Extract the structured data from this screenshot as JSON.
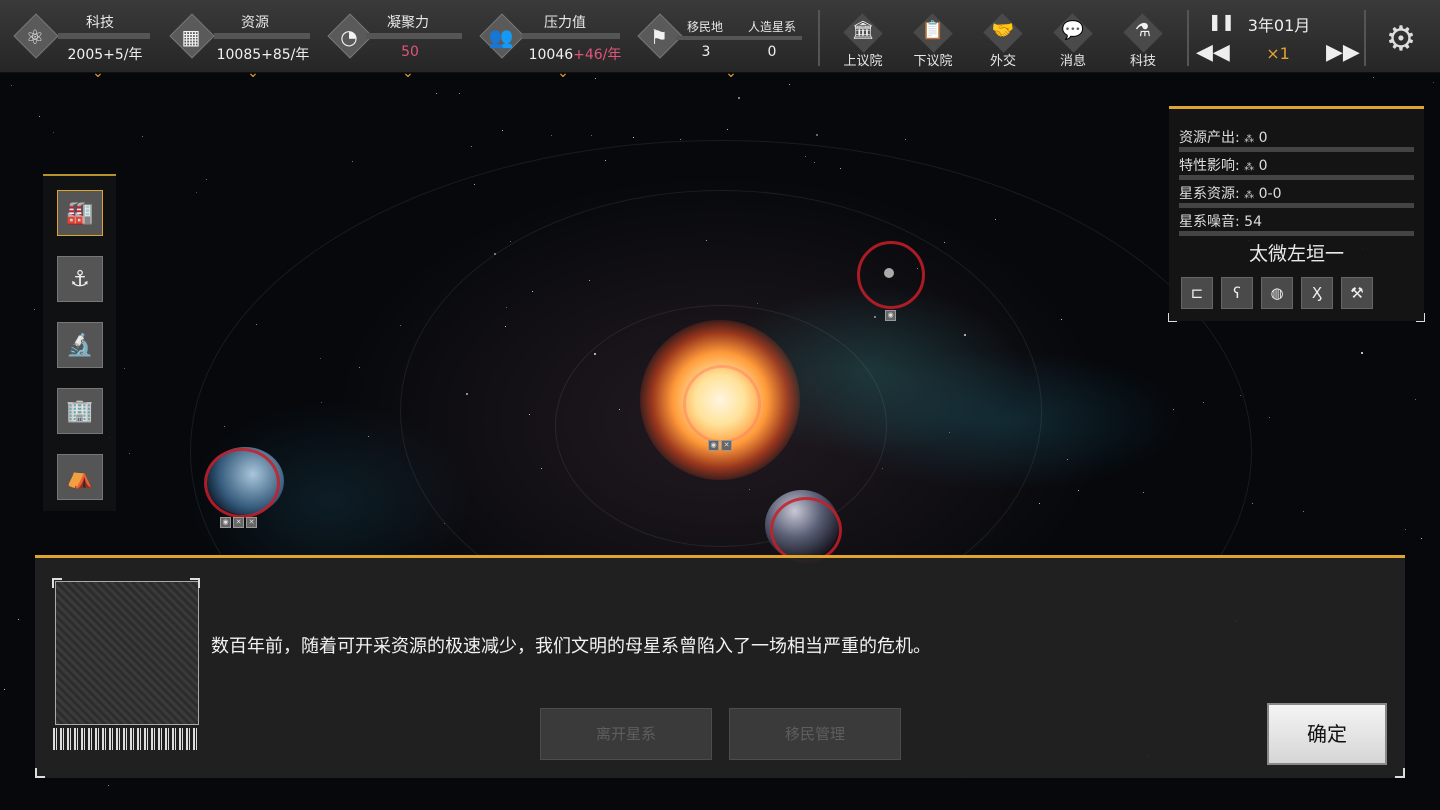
{
  "topbar": {
    "stats": [
      {
        "label": "科技",
        "value": "2005+5/年",
        "icon": "atom-icon"
      },
      {
        "label": "资源",
        "value": "10085+85/年",
        "icon": "cubes-icon"
      },
      {
        "label": "凝聚力",
        "value": "50",
        "value_color": "#e0557a",
        "icon": "aperture-icon"
      }
    ],
    "pressure": {
      "label": "压力值",
      "value_base": "10046",
      "value_delta": "+46/年",
      "delta_color": "#e0557a",
      "icon": "people-icon"
    },
    "colony": {
      "label_colonies": "移民地",
      "value_colonies": "3",
      "label_artificial": "人造星系",
      "value_artificial": "0",
      "icon": "flag-icon"
    },
    "buttons": [
      {
        "label": "上议院",
        "icon": "senate-icon"
      },
      {
        "label": "下议院",
        "icon": "clipboard-check-icon"
      },
      {
        "label": "外交",
        "icon": "handshake-icon"
      },
      {
        "label": "消息",
        "icon": "message-icon"
      },
      {
        "label": "科技",
        "icon": "flask-icon"
      }
    ],
    "time": {
      "date": "3年01月",
      "speed": "×1"
    }
  },
  "info_panel": {
    "rows": [
      {
        "label": "资源产出:",
        "value": "0"
      },
      {
        "label": "特性影响:",
        "value": "0"
      },
      {
        "label": "星系资源:",
        "value": "0-0"
      },
      {
        "label": "星系噪音:",
        "value": "54"
      }
    ],
    "system_name": "太微左垣一",
    "traits": [
      "circuit-icon",
      "ear-icon",
      "globe-icon",
      "figure-icon",
      "axe-icon"
    ]
  },
  "left_toolbar": [
    "factory-icon",
    "anchor-icon",
    "microscope-icon",
    "city-icon",
    "dome-icon"
  ],
  "dialog": {
    "text": "数百年前，随着可开采资源的极速减少，我们文明的母星系曾陷入了一场相当严重的危机。",
    "buttons_disabled": [
      "离开星系",
      "移民管理"
    ],
    "confirm": "确定"
  },
  "colors": {
    "accent": "#e0a531",
    "warning": "#e0557a"
  }
}
